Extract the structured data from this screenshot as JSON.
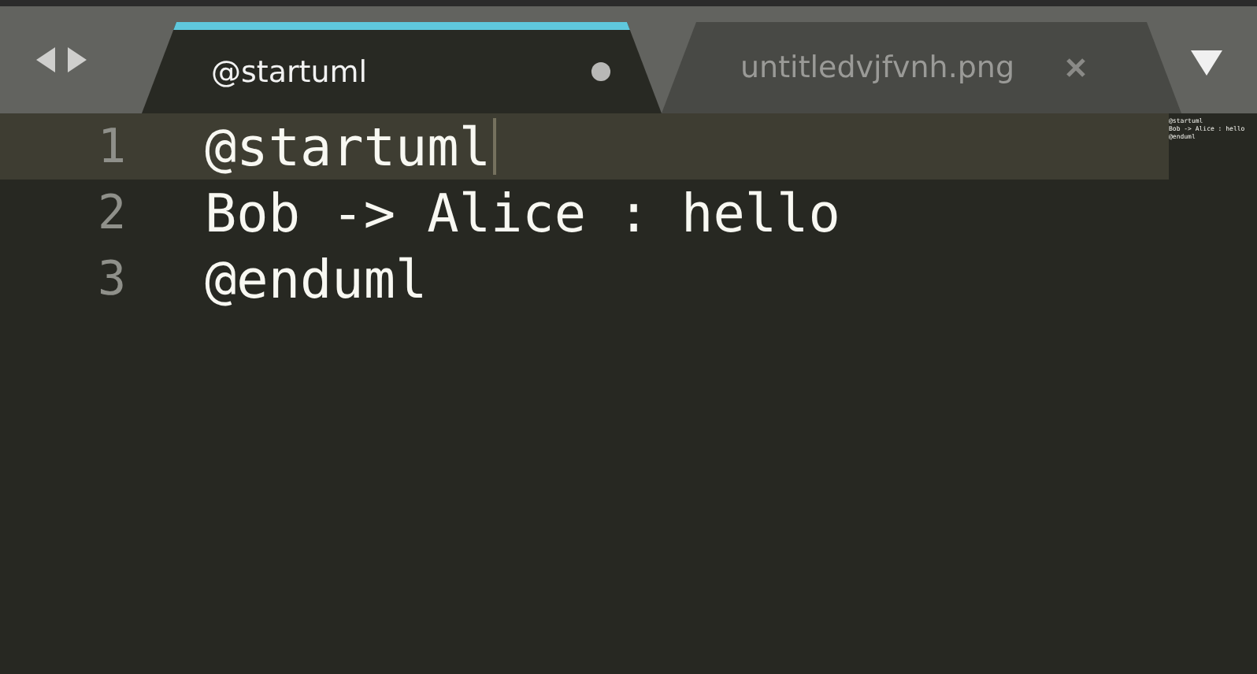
{
  "tabs": [
    {
      "label": "@startuml",
      "selected": true,
      "modified": true
    },
    {
      "label": "untitledvjfvnh.png",
      "selected": false,
      "modified": false
    }
  ],
  "lines": [
    {
      "number": "1",
      "text": "@startuml",
      "current": true
    },
    {
      "number": "2",
      "text": "Bob -> Alice : hello",
      "current": false
    },
    {
      "number": "3",
      "text": "@enduml",
      "current": false
    }
  ],
  "minimap": {
    "lines": [
      "@startuml",
      "Bob -> Alice : hello",
      "@enduml"
    ]
  }
}
